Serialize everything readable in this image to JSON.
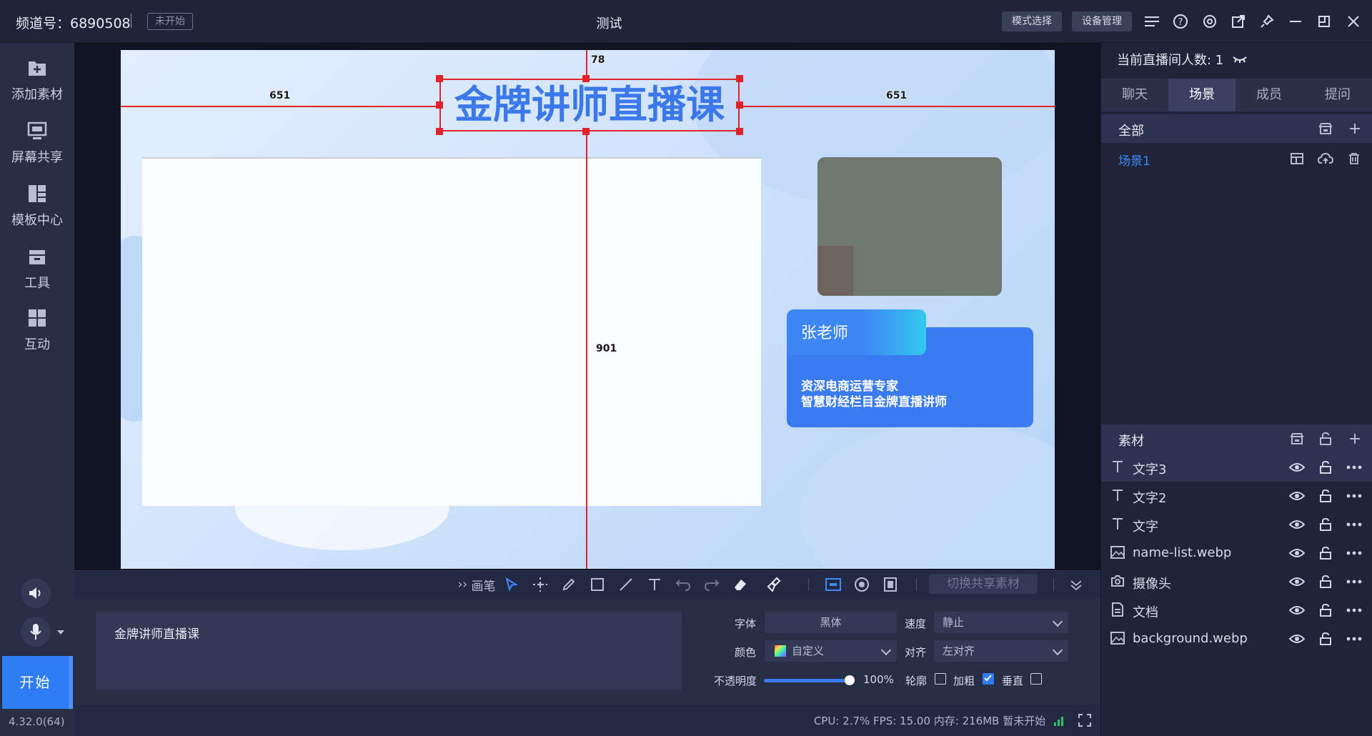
{
  "topbar": {
    "channel": "频道号：6890508",
    "status": "未开始",
    "title": "测试",
    "mode_button": "模式选择",
    "device_button": "设备管理"
  },
  "sidebar": {
    "items": [
      {
        "label": "添加素材",
        "icon": "add-material-icon"
      },
      {
        "label": "屏幕共享",
        "icon": "screen-share-icon"
      },
      {
        "label": "模板中心",
        "icon": "template-icon"
      },
      {
        "label": "工具",
        "icon": "toolbox-icon"
      },
      {
        "label": "互动",
        "icon": "interaction-icon"
      }
    ],
    "start_label": "开始",
    "version": "4.32.0(64)"
  },
  "canvas": {
    "title_text": "金牌讲师直播课",
    "measure_top": "78",
    "measure_left": "651",
    "measure_right": "651",
    "measure_bottom": "901",
    "teacher_name": "张老师",
    "teacher_line1": "资深电商运营专家",
    "teacher_line2": "智慧财经栏目金牌直播讲师"
  },
  "toolbar": {
    "pen_label": "画笔",
    "switch_share": "切换共享素材"
  },
  "props": {
    "text_value": "金牌讲师直播课",
    "font_label": "字体",
    "font_value": "黑体",
    "speed_label": "速度",
    "speed_value": "静止",
    "color_label": "颜色",
    "color_value": "自定义",
    "align_label": "对齐",
    "align_value": "左对齐",
    "opacity_label": "不透明度",
    "opacity_value": "100%",
    "opacity_level": 1.0,
    "outline_label": "轮廓",
    "bold_label": "加粗",
    "vertical_label": "垂直",
    "outline_checked": false,
    "bold_checked": true,
    "vertical_checked": false
  },
  "status": {
    "text": "CPU: 2.7%   FPS: 15.00   内存: 216MB   暂未开始"
  },
  "rpanel": {
    "viewers_label": "当前直播间人数:  1",
    "tabs": [
      "聊天",
      "场景",
      "成员",
      "提问"
    ],
    "active_tab": "场景",
    "scene_section": "全部",
    "scenes": [
      "场景1"
    ],
    "material_section": "素材",
    "materials": [
      {
        "name": "文字3",
        "icon": "text-icon"
      },
      {
        "name": "文字2",
        "icon": "text-icon"
      },
      {
        "name": "文字",
        "icon": "text-icon"
      },
      {
        "name": "name-list.webp",
        "icon": "image-icon"
      },
      {
        "name": "摄像头",
        "icon": "camera-icon"
      },
      {
        "name": "文档",
        "icon": "document-icon"
      },
      {
        "name": "background.webp",
        "icon": "image-icon"
      }
    ]
  },
  "colors": {
    "accent": "#2f7df6",
    "guide": "#e0232a",
    "title_text": "#3b78ec"
  }
}
